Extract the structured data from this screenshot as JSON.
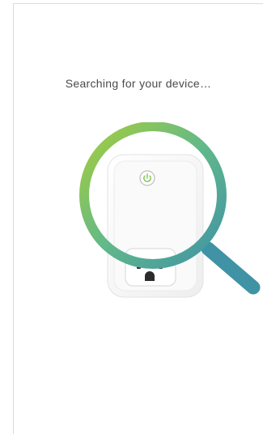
{
  "status": {
    "title": "Searching for your device…"
  },
  "illustration": {
    "device": "smart-plug",
    "power_icon": "power-icon",
    "search_icon": "magnifier-icon",
    "colors": {
      "ring_start": "#a6cd3b",
      "ring_mid": "#54b58a",
      "ring_end": "#3f93a5",
      "power_led": "#7cc24a"
    }
  }
}
